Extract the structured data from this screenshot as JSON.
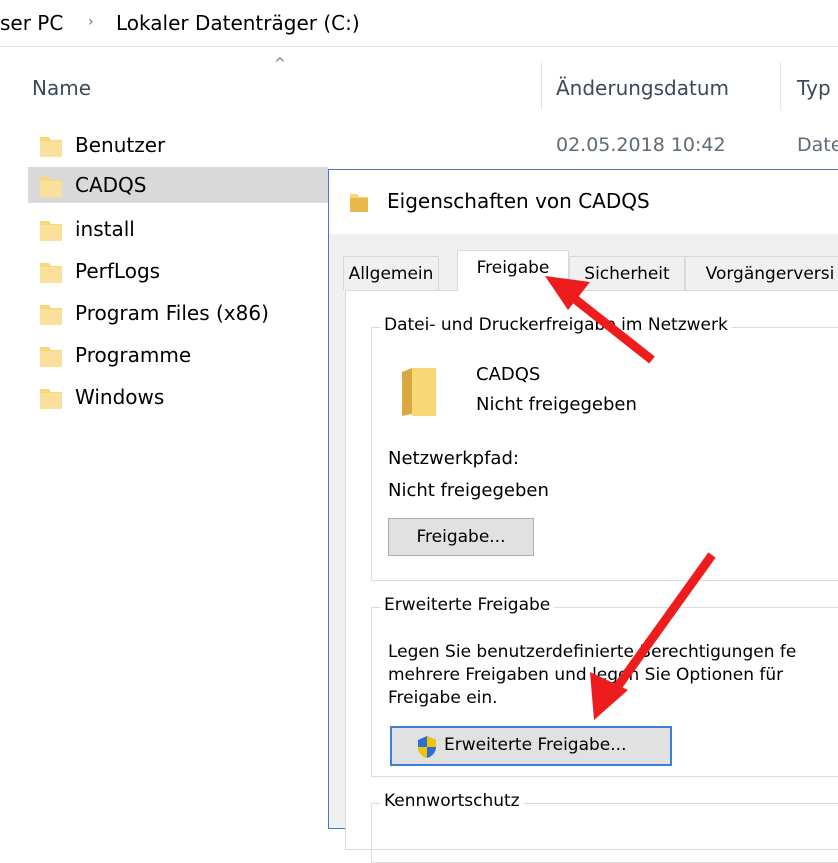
{
  "breadcrumb": {
    "this_pc": "ser PC",
    "separator": "›",
    "drive": "Lokaler Datenträger (C:)"
  },
  "columns": {
    "name": "Name",
    "date": "Änderungsdatum",
    "type": "Typ"
  },
  "files": [
    {
      "name": "Benutzer",
      "date": "02.05.2018 10:42",
      "type": "Date"
    },
    {
      "name": "CADQS"
    },
    {
      "name": "install"
    },
    {
      "name": "PerfLogs"
    },
    {
      "name": "Program Files (x86)"
    },
    {
      "name": "Programme"
    },
    {
      "name": "Windows"
    }
  ],
  "dialog": {
    "title": "Eigenschaften von CADQS",
    "tabs": [
      "Allgemein",
      "Freigabe",
      "Sicherheit",
      "Vorgängerversi"
    ],
    "active_tab": "Freigabe",
    "network_sharing": {
      "caption": "Datei- und Druckerfreigabe im Netzwerk",
      "folder_name": "CADQS",
      "status": "Nicht freigegeben",
      "path_label": "Netzwerkpfad:",
      "path_value": "Nicht freigegeben",
      "share_button": "Freigabe..."
    },
    "advanced_sharing": {
      "caption": "Erweiterte Freigabe",
      "desc_line1": "Legen Sie benutzerdefinierte Berechtigungen fe",
      "desc_line2": "mehrere Freigaben und legen Sie Optionen für",
      "desc_line3": "Freigabe ein.",
      "button": "Erweiterte Freigabe..."
    },
    "password_protection": {
      "caption": "Kennwortschutz"
    }
  },
  "colors": {
    "annotation_arrow": "#ee1c1c",
    "selection": "#d9d9d9",
    "folder": "#f8d775"
  }
}
